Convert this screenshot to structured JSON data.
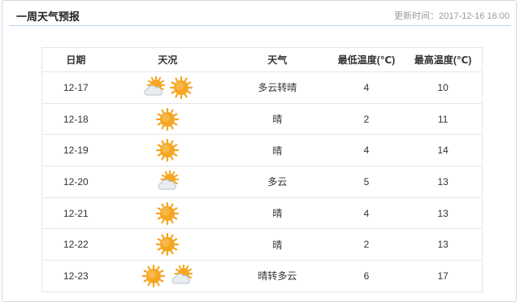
{
  "header": {
    "title": "一周天气预报",
    "update_label": "更新时间：",
    "update_time": "2017-12-16 16:00"
  },
  "columns": [
    "日期",
    "天况",
    "天气",
    "最低温度(℃)",
    "最高温度(℃)"
  ],
  "rows": [
    {
      "date": "12-17",
      "icons": [
        "cloudy-sun-icon",
        "sun-icon"
      ],
      "weather": "多云转晴",
      "low": "4",
      "high": "10"
    },
    {
      "date": "12-18",
      "icons": [
        "sun-icon"
      ],
      "weather": "晴",
      "low": "2",
      "high": "11"
    },
    {
      "date": "12-19",
      "icons": [
        "sun-icon"
      ],
      "weather": "晴",
      "low": "4",
      "high": "14"
    },
    {
      "date": "12-20",
      "icons": [
        "cloudy-sun-icon"
      ],
      "weather": "多云",
      "low": "5",
      "high": "13"
    },
    {
      "date": "12-21",
      "icons": [
        "sun-icon"
      ],
      "weather": "晴",
      "low": "4",
      "high": "13"
    },
    {
      "date": "12-22",
      "icons": [
        "sun-icon"
      ],
      "weather": "晴",
      "low": "2",
      "high": "13"
    },
    {
      "date": "12-23",
      "icons": [
        "sun-icon",
        "cloudy-sun-icon"
      ],
      "weather": "晴转多云",
      "low": "6",
      "high": "17"
    }
  ],
  "colors": {
    "header_border": "#bcd3e8",
    "sun": "#f5a623",
    "cloud": "#e9edf1"
  }
}
